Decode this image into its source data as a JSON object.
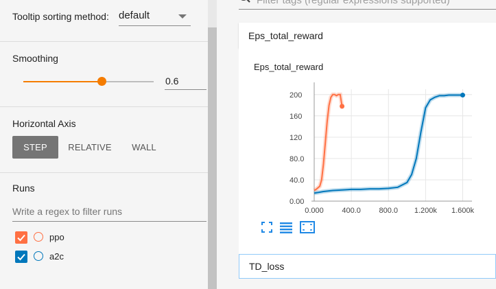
{
  "sidebar": {
    "tooltip": {
      "label": "Tooltip sorting method:",
      "value": "default"
    },
    "smoothing": {
      "title": "Smoothing",
      "value": "0.6",
      "fraction": 0.6
    },
    "horizontal_axis": {
      "title": "Horizontal Axis",
      "options": [
        "STEP",
        "RELATIVE",
        "WALL"
      ],
      "selected": "STEP"
    },
    "runs": {
      "title": "Runs",
      "filter_placeholder": "Write a regex to filter runs",
      "items": [
        {
          "name": "ppo",
          "checked": true,
          "color": "#ff7043"
        },
        {
          "name": "a2c",
          "checked": true,
          "color": "#0077bb"
        }
      ]
    }
  },
  "main": {
    "filter_tags_placeholder": "Filter tags (regular expressions supported)",
    "group_title": "Eps_total_reward",
    "next_group_title": "TD_loss",
    "chart_controls": [
      "fullscreen-icon",
      "toggle-y-log-icon",
      "fit-domain-icon"
    ]
  },
  "chart_data": {
    "type": "line",
    "title": "Eps_total_reward",
    "xlabel": "",
    "ylabel": "",
    "xlim": [
      0,
      1700
    ],
    "ylim": [
      0,
      210
    ],
    "x_ticks": [
      "0.000",
      "400.0",
      "800.0",
      "1.200k",
      "1.600k"
    ],
    "y_ticks": [
      "0.00",
      "40.0",
      "80.0",
      "120",
      "160",
      "200"
    ],
    "grid": true,
    "series": [
      {
        "name": "ppo",
        "color": "#ff7043",
        "x": [
          0,
          20,
          40,
          60,
          80,
          100,
          120,
          140,
          160,
          180,
          200,
          220,
          240,
          260,
          280,
          300
        ],
        "y": [
          20,
          22,
          25,
          28,
          40,
          70,
          110,
          150,
          180,
          195,
          200,
          200,
          198,
          200,
          200,
          178
        ]
      },
      {
        "name": "a2c",
        "color": "#0077bb",
        "x": [
          0,
          100,
          200,
          300,
          400,
          500,
          600,
          700,
          800,
          900,
          1000,
          1050,
          1100,
          1150,
          1200,
          1250,
          1300,
          1350,
          1400,
          1450,
          1500,
          1550,
          1600
        ],
        "y": [
          15,
          18,
          20,
          21,
          22,
          22,
          23,
          23,
          24,
          26,
          35,
          50,
          80,
          130,
          175,
          190,
          195,
          198,
          198,
          199,
          199,
          199,
          199
        ]
      }
    ]
  }
}
